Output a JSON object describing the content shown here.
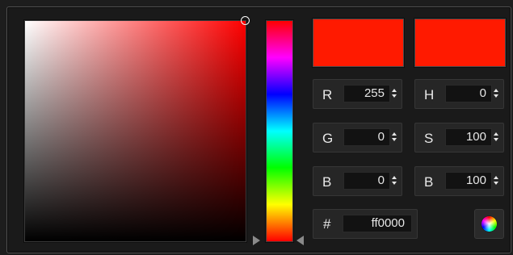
{
  "color": {
    "current_hex_color": "#ff1a00",
    "previous_hex_color": "#ff1a00",
    "hue_base_color": "#ff0000"
  },
  "rgb": [
    {
      "label": "R",
      "value": "255"
    },
    {
      "label": "G",
      "value": "0"
    },
    {
      "label": "B",
      "value": "0"
    }
  ],
  "hsb": [
    {
      "label": "H",
      "value": "0"
    },
    {
      "label": "S",
      "value": "100"
    },
    {
      "label": "B",
      "value": "100"
    }
  ],
  "hex": {
    "label": "#",
    "value": "ff0000"
  },
  "icons": {
    "saturation_cursor": "circle-cursor-icon",
    "hue_slider_left": "triangle-right-icon",
    "hue_slider_right": "triangle-left-icon",
    "spinner": "spinner-arrows-icon",
    "color_wheel": "color-wheel-icon"
  }
}
